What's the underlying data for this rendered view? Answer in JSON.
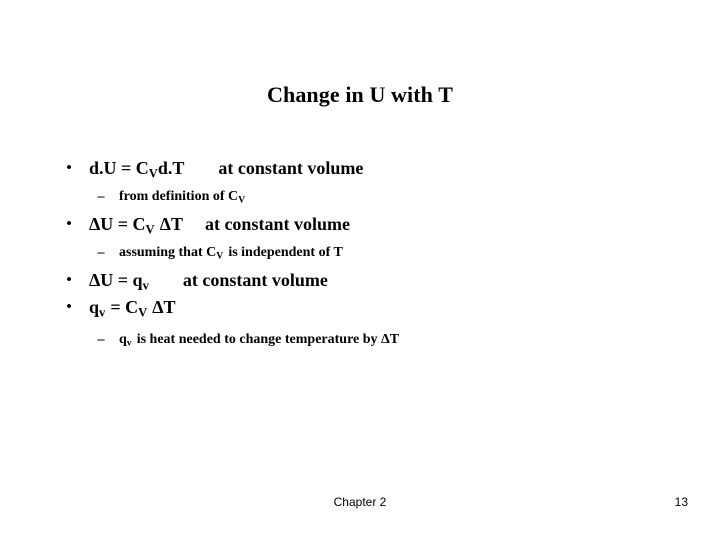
{
  "slide": {
    "title": "Change in U with T",
    "bullet_glyph": "•",
    "dash_glyph": "–",
    "text_color": "#000000",
    "background_color": "#ffffff",
    "items": [
      {
        "level": 1,
        "eq_lead": "d.U = C",
        "eq_sub": "V",
        "eq_tail": "d.T",
        "note": "at constant volume"
      },
      {
        "level": 2,
        "eq_lead": "from definition of C",
        "eq_sub": "V",
        "eq_tail": "",
        "note": ""
      },
      {
        "level": 1,
        "eq_lead": "ΔU =  C",
        "eq_sub": "V",
        "eq_tail": "ΔT",
        "note": "at constant volume"
      },
      {
        "level": 2,
        "eq_lead": "assuming  that C",
        "eq_sub": "V",
        "eq_tail": "is independent of T",
        "note": ""
      },
      {
        "level": 1,
        "eq_lead": "ΔU = q",
        "eq_sub": "v",
        "eq_tail": "",
        "note": "at constant volume"
      },
      {
        "level": 1,
        "eq_lead": "q",
        "eq_sub": "v",
        "eq_tail": "= C",
        "eq_sub2": "V",
        "eq_tail2": "ΔT",
        "note": ""
      },
      {
        "level": 2,
        "eq_lead": "q",
        "eq_sub": "v",
        "eq_tail": "is heat needed to change temperature by  ΔT",
        "note": ""
      }
    ]
  },
  "footer": {
    "chapter": "Chapter 2",
    "page_number": "13"
  }
}
